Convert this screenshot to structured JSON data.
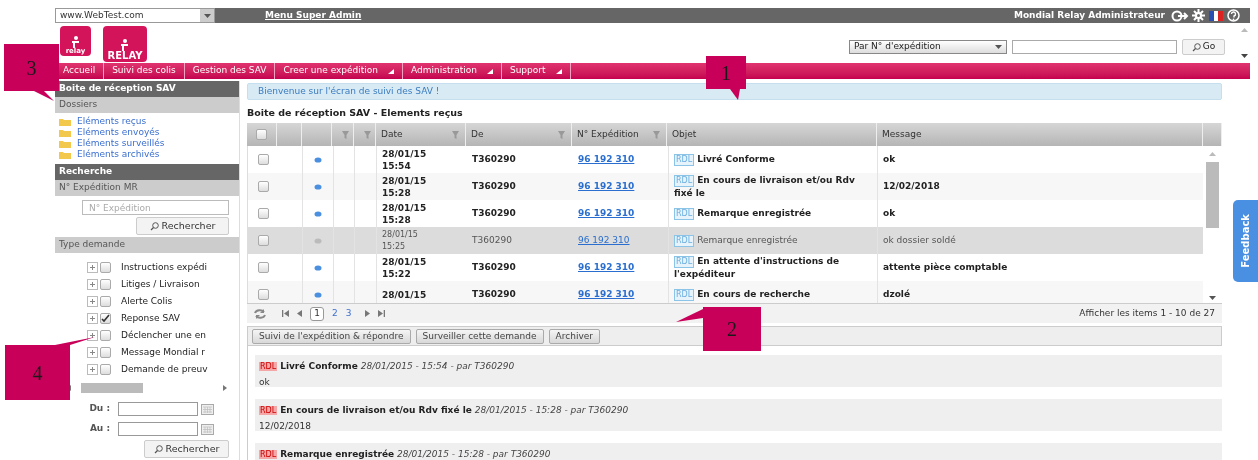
{
  "site_select": {
    "value": "www.WebTest.com"
  },
  "top_bar": {
    "menu_link": "Menu Super Admin",
    "user": "Mondial Relay Administrateur"
  },
  "logos": [
    {
      "text": "relay"
    },
    {
      "text": "RELAY"
    }
  ],
  "quick_search": {
    "mode": "Par N° d'expédition",
    "button": "Go"
  },
  "nav": [
    {
      "label": "Accueil",
      "dropdown": false
    },
    {
      "label": "Suivi des colis",
      "dropdown": false
    },
    {
      "label": "Gestion des SAV",
      "dropdown": false
    },
    {
      "label": "Creer une expédition",
      "dropdown": true
    },
    {
      "label": "Administration",
      "dropdown": true
    },
    {
      "label": "Support",
      "dropdown": true
    }
  ],
  "sidebar": {
    "title": "Boite de réception SAV",
    "folders_heading": "Dossiers",
    "folders": [
      "Eléments reçus",
      "Eléments envoyés",
      "Eléments surveillés",
      "Eléments archivés"
    ],
    "search_heading": "Recherche",
    "shipment_heading": "N° Expédition MR",
    "shipment_placeholder": "N° Expédition",
    "search_button": "Rechercher",
    "type_heading": "Type demande",
    "types": [
      {
        "label": "Instructions expédi",
        "checked": false
      },
      {
        "label": "Litiges / Livraison",
        "checked": false
      },
      {
        "label": "Alerte Colis",
        "checked": false
      },
      {
        "label": "Reponse SAV",
        "checked": true
      },
      {
        "label": "Déclencher une en",
        "checked": false
      },
      {
        "label": "Message Mondial r",
        "checked": false
      },
      {
        "label": "Demande de preuv",
        "checked": false
      }
    ],
    "from_label": "Du :",
    "to_label": "Au :",
    "date_search_button": "Rechercher"
  },
  "welcome": "Bienvenue sur l'écran de suivi des SAV !",
  "inbox_title": "Boite de réception SAV - Elements reçus",
  "table": {
    "select_all_checked": false,
    "columns": [
      "Date",
      "De",
      "N° Expédition",
      "Objet",
      "Message"
    ],
    "rows": [
      {
        "date": "28/01/15",
        "time": "15:54",
        "from": "T360290",
        "shipment": "96 192 310",
        "tag": "RDL",
        "subject": "Livré Conforme",
        "message": "ok",
        "read": false
      },
      {
        "date": "28/01/15",
        "time": "15:28",
        "from": "T360290",
        "shipment": "96 192 310",
        "tag": "RDL",
        "subject": "En cours de livraison et/ou Rdv fixé le",
        "message": "12/02/2018",
        "read": false
      },
      {
        "date": "28/01/15",
        "time": "15:28",
        "from": "T360290",
        "shipment": "96 192 310",
        "tag": "RDL",
        "subject": "Remarque enregistrée",
        "message": "ok",
        "read": false
      },
      {
        "date": "28/01/15",
        "time": "15:25",
        "from": "T360290",
        "shipment": "96 192 310",
        "tag": "RDL",
        "subject": "Remarque enregistrée",
        "message": "ok dossier soldé",
        "read": true
      },
      {
        "date": "28/01/15",
        "time": "15:22",
        "from": "T360290",
        "shipment": "96 192 310",
        "tag": "RDL",
        "subject": "En attente d'instructions de l'expéditeur",
        "message": "attente pièce comptable",
        "read": false
      },
      {
        "date": "28/01/15",
        "time": "",
        "from": "T360290",
        "shipment": "96 192 310",
        "tag": "RDL",
        "subject": "En cours de recherche",
        "message": "dzolé",
        "read": false
      }
    ]
  },
  "pager": {
    "pages": [
      {
        "label": "1",
        "selected": true
      },
      {
        "label": "2",
        "selected": false
      },
      {
        "label": "3",
        "selected": false
      }
    ],
    "summary": "Afficher les items 1 - 10 de 27"
  },
  "actions": [
    "Suivi de l'expédition & répondre",
    "Surveiller cette demande",
    "Archiver"
  ],
  "messages": [
    {
      "tag": "RDL",
      "subject": "Livré Conforme",
      "meta": "28/01/2015 - 15:54 - par T360290",
      "body": "ok"
    },
    {
      "tag": "RDL",
      "subject": "En cours de livraison et/ou Rdv fixé le",
      "meta": "28/01/2015 - 15:28 - par T360290",
      "body": "12/02/2018"
    },
    {
      "tag": "RDL",
      "subject": "Remarque enregistrée",
      "meta": "28/01/2015 - 15:28 - par T360290"
    }
  ],
  "feedback": "Feedback",
  "callouts": [
    {
      "label": "3"
    },
    {
      "label": "1"
    },
    {
      "label": "2"
    },
    {
      "label": "4"
    }
  ]
}
